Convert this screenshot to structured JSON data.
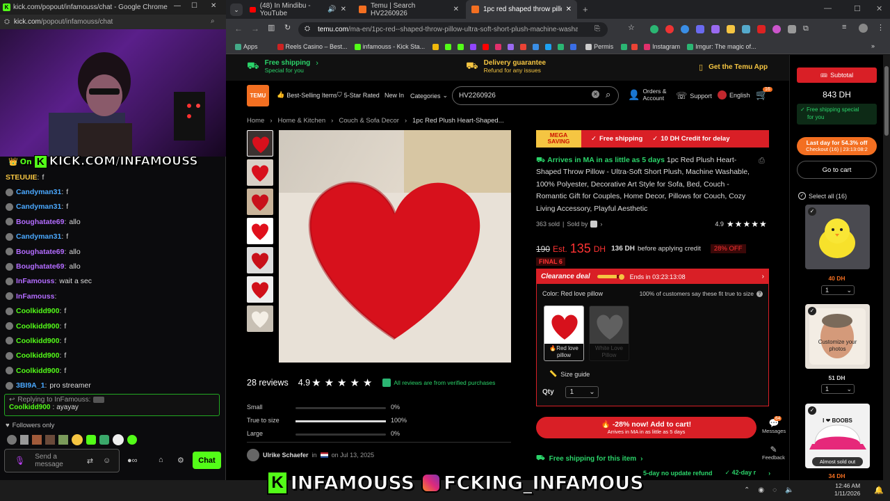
{
  "kick_window": {
    "title": "kick.com/popout/infamouss/chat - Google Chrome",
    "url_domain": "kick.com",
    "url_path": "/popout/infamouss/chat",
    "webcam_banner": "KICK.COM/INFAMOUSS",
    "banner_prefix": "On"
  },
  "chat": {
    "messages": [
      {
        "user": "STEUUIE",
        "color": "#f5c542",
        "text": "f"
      },
      {
        "user": "Candyman31",
        "color": "#4aa8ff",
        "text": "f"
      },
      {
        "user": "Candyman31",
        "color": "#4aa8ff",
        "text": "f"
      },
      {
        "user": "Boughatate69",
        "color": "#b36cff",
        "text": "allo"
      },
      {
        "user": "Candyman31",
        "color": "#4aa8ff",
        "text": "f"
      },
      {
        "user": "Boughatate69",
        "color": "#b36cff",
        "text": "allo"
      },
      {
        "user": "Boughatate69",
        "color": "#b36cff",
        "text": "allo"
      },
      {
        "user": "InFamouss",
        "color": "#b36cff",
        "text": "wait a sec"
      },
      {
        "user": "InFamouss",
        "color": "#b36cff",
        "text": ""
      },
      {
        "user": "Coolkidd900",
        "color": "#53fc18",
        "text": "f"
      },
      {
        "user": "Coolkidd900",
        "color": "#53fc18",
        "text": "f"
      },
      {
        "user": "Coolkidd900",
        "color": "#53fc18",
        "text": "f"
      },
      {
        "user": "Coolkidd900",
        "color": "#53fc18",
        "text": "f"
      },
      {
        "user": "Coolkidd900",
        "color": "#53fc18",
        "text": "f"
      },
      {
        "user": "3BI9A_1",
        "color": "#4aa8ff",
        "text": "pro streamer"
      }
    ],
    "reply_label": "Replying to InFamouss:",
    "reply_user": "Coolkidd900",
    "reply_text": "ayayay",
    "followers_only": "Followers only",
    "send_placeholder_1": "Send a",
    "send_placeholder_2": "message",
    "chat_button": "Chat"
  },
  "browser": {
    "tabs": [
      {
        "label": "(48) In Mindibu - YouTube",
        "active": false
      },
      {
        "label": "Temu | Search HV2260926",
        "active": false
      },
      {
        "label": "1pc red shaped throw pillow ul",
        "active": true
      }
    ],
    "url_domain": "temu.com",
    "url_path": "/ma-en/1pc-red--shaped-throw-pillow-ultra-soft-short-plush-machine-washable-100-pol...",
    "bookmarks": [
      "Apps",
      "Reels Casino – Best...",
      "infamouss - Kick Sta...",
      "Permis",
      "Instagram",
      "Imgur: The magic of..."
    ]
  },
  "temu": {
    "promo": {
      "free_shipping": "Free shipping",
      "free_shipping_sub": "Special for you",
      "delivery": "Delivery guarantee",
      "delivery_sub": "Refund for any issues",
      "get_app": "Get the Temu App"
    },
    "nav": {
      "logo": "TEMU",
      "best_selling": "Best-Selling Items",
      "five_star": "5-Star Rated",
      "new_in": "New In",
      "categories": "Categories",
      "search_value": "HV2260926",
      "orders": "Orders &",
      "account": "Account",
      "support": "Support",
      "language": "English",
      "cart_count": "16"
    },
    "breadcrumbs": [
      "Home",
      "Home & Kitchen",
      "Couch & Sofa Decor",
      "1pc Red Plush Heart-Shaped..."
    ],
    "reviews": {
      "count": "28 reviews",
      "rating": "4.9",
      "verified": "All reviews are from verified purchases",
      "fit": [
        {
          "label": "Small",
          "percent": "0%",
          "value": 0
        },
        {
          "label": "True to size",
          "percent": "100%",
          "value": 100
        },
        {
          "label": "Large",
          "percent": "0%",
          "value": 0
        }
      ],
      "reviewer": "Ulrike Schaefer",
      "reviewer_in": "in",
      "review_date": "on Jul 13, 2025"
    },
    "product": {
      "mega_1": "MEGA",
      "mega_2": "SAVING",
      "badge_shipping": "Free shipping",
      "badge_credit": "10 DH Credit for delay",
      "arrives": "Arrives in MA in as little as 5 days",
      "title": "1pc Red Plush Heart-Shaped Throw Pillow - Ultra-Soft Short Plush, Machine Washable, 100% Polyester, Decorative Art Style for Sofa, Bed, Couch - Romantic Gift for Couples, Home Decor, Pillows for Couch, Cozy Living Accessory, Playful Aesthetic",
      "sold": "363 sold",
      "sold_by": "Sold by",
      "rating": "4.9",
      "old_price": "190",
      "est": "Est.",
      "price": "135",
      "currency": "DH",
      "before_credit": "136 DH",
      "before_credit_text": "before applying credit",
      "discount": "28% OFF",
      "final": "FINAL 6"
    },
    "clearance": {
      "title": "Clearance deal",
      "ends": "Ends in 03:23:13:08",
      "color_label": "Color: Red love pillow",
      "fit_note": "100% of customers say these fit true to size",
      "option_1": "Red love pillow",
      "option_2": "White Love Pillow",
      "size_guide": "Size guide",
      "qty_label": "Qty",
      "qty_value": "1"
    },
    "add_to_cart": "-28% now! Add to cart!",
    "add_to_cart_sub": "Arrives in MA in as little as 5 days",
    "free_shipping_item": "Free shipping for this item",
    "refund_1": "5-day no update refund",
    "refund_2": "42-day r",
    "messages": "Messages",
    "messages_badge": "64",
    "feedback": "Feedback"
  },
  "cart": {
    "subtotal_label": "Subtotal",
    "subtotal": "843 DH",
    "free_ship_1": "Free shipping special",
    "free_ship_2": "for you",
    "last_day": "Last day for 54.3% off",
    "checkout": "Checkout (16) | 23:13:08:2",
    "go_to_cart": "Go to cart",
    "select_all": "Select all (16)",
    "items": [
      {
        "price": "40 DH",
        "qty": "1"
      },
      {
        "price": "51 DH",
        "qty": "1",
        "overlay": "Customize your photos"
      },
      {
        "price": "34 DH",
        "qty": "",
        "overlay": "Almost sold out",
        "cap_text": "I ❤ BOOBS"
      }
    ]
  },
  "overlay": {
    "kick": "INFAMOUSS",
    "instagram": "FCKING_INFAMOUS"
  },
  "taskbar": {
    "time": "12:46 AM",
    "date": "1/11/2026"
  },
  "colors": {
    "kick_green": "#53fc18",
    "temu_red": "#d91f26",
    "temu_orange": "#f36f21"
  }
}
